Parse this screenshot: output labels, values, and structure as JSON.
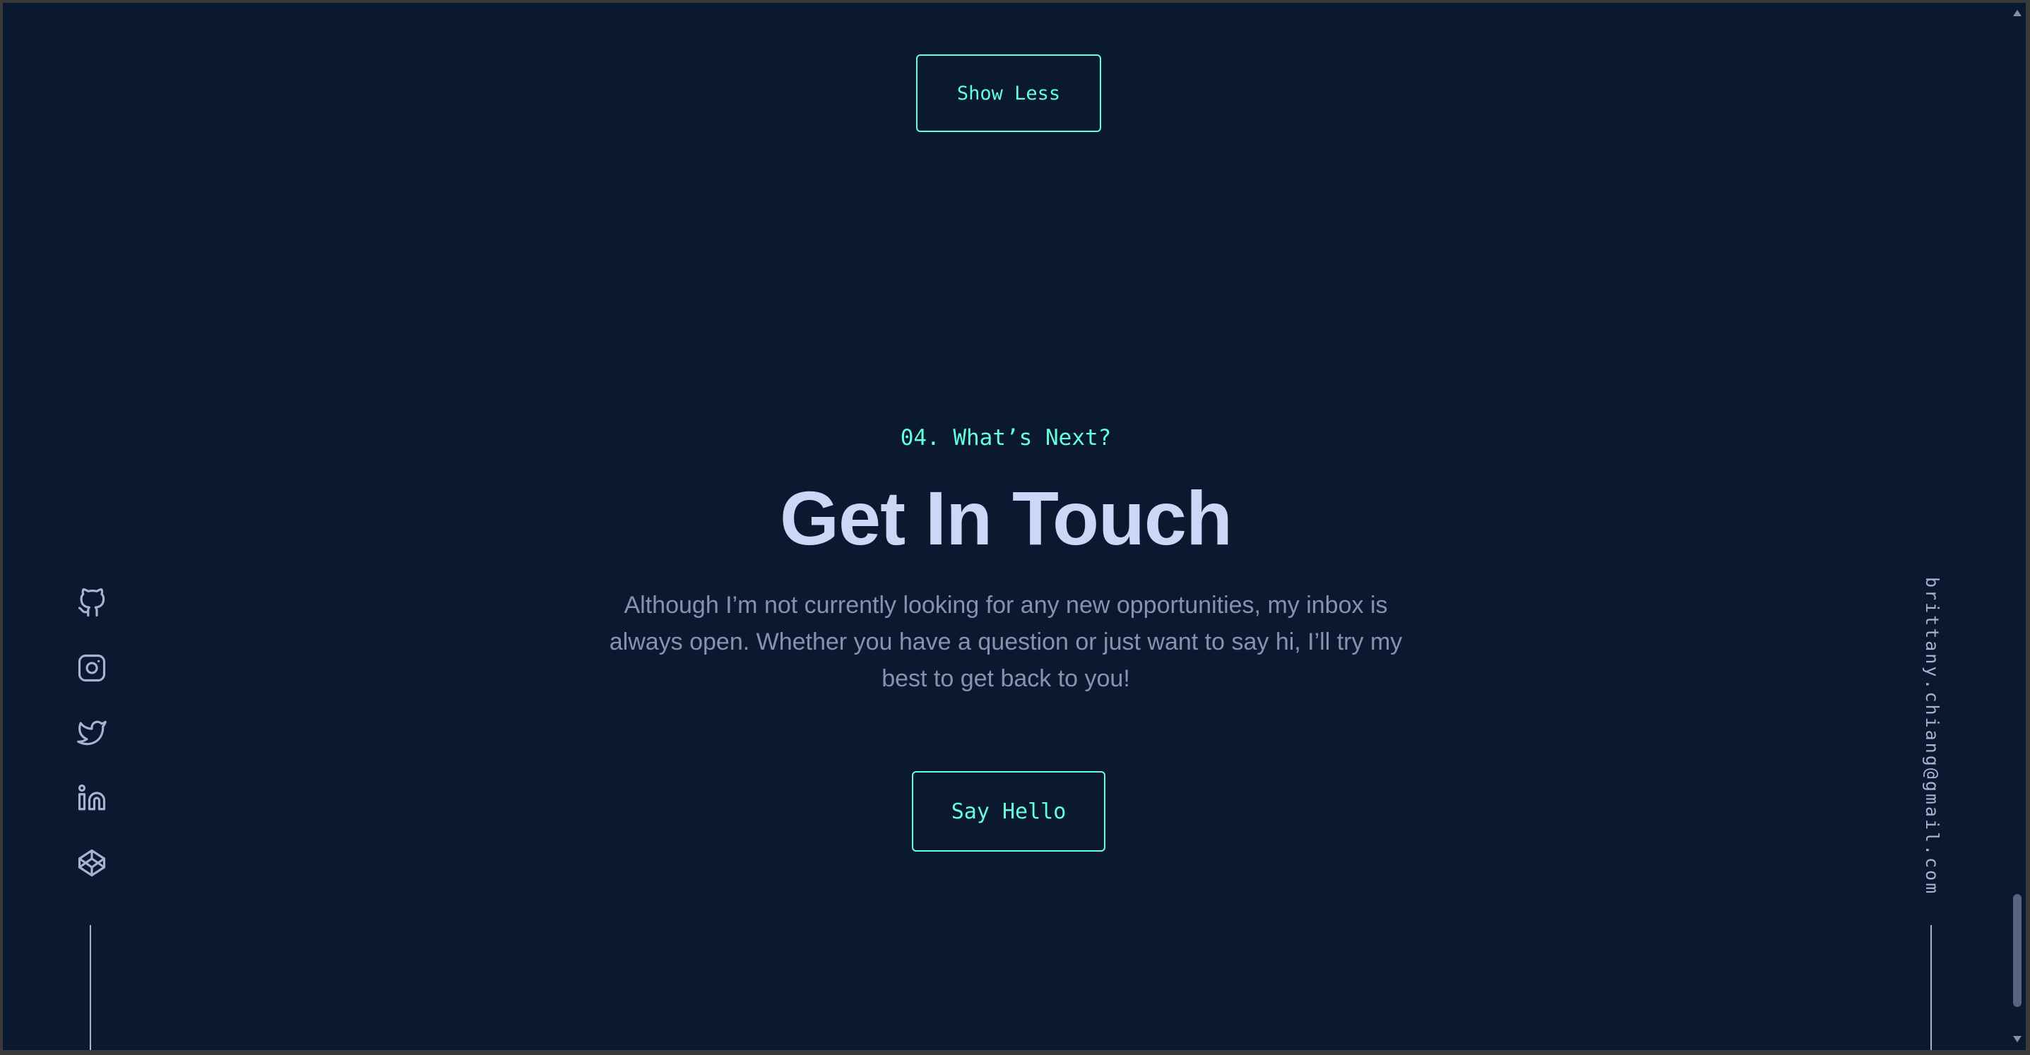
{
  "projects": {
    "show_less_label": "Show Less"
  },
  "contact": {
    "overline": "04. What’s Next?",
    "title": "Get In Touch",
    "description": "Although I’m not currently looking for any new opportunities, my inbox is always open. Whether you have a question or just want to say hi, I’ll try my best to get back to you!",
    "cta_label": "Say Hello"
  },
  "social": {
    "icons": [
      "github-icon",
      "instagram-icon",
      "twitter-icon",
      "linkedin-icon",
      "codepen-icon"
    ]
  },
  "email": {
    "address": "brittany.chiang@gmail.com"
  },
  "colors": {
    "background": "#0a192f",
    "accent": "#64ffda",
    "heading": "#ccd6f6",
    "body_text": "#8892b0",
    "icon": "#a8b2d1"
  }
}
